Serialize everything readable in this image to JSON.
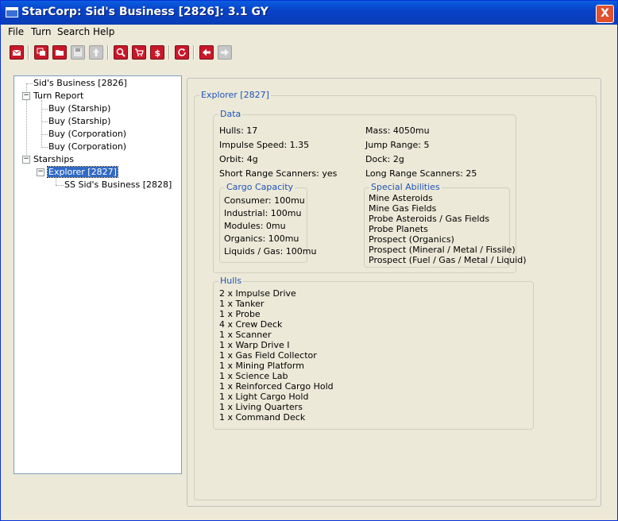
{
  "window": {
    "title": "StarCorp: Sid's Business [2826]: 3.1 GY",
    "close_label": "X"
  },
  "menu": [
    "File",
    "Turn",
    "Search",
    "Help"
  ],
  "toolbar": {
    "buttons": [
      "mail-icon",
      "copy-window-icon",
      "open-folder-icon",
      "save-icon",
      "upload-icon",
      "search-icon",
      "cart-icon",
      "dollar-icon",
      "refresh-icon",
      "back-arrow-icon",
      "forward-arrow-icon"
    ]
  },
  "tree": {
    "root": "Sid's Business [2826]",
    "turn_report": "Turn Report",
    "turn_items": [
      "Buy (Starship)",
      "Buy (Starship)",
      "Buy (Corporation)",
      "Buy (Corporation)"
    ],
    "starships": "Starships",
    "explorer": "Explorer [2827]",
    "ss": "SS Sid's Business [2828]"
  },
  "panel": {
    "title": "Explorer [2827]",
    "data_label": "Data",
    "data_left": [
      "Hulls: 17",
      "Impulse Speed: 1.35",
      "Orbit: 4g",
      "Short Range Scanners: yes"
    ],
    "data_right": [
      "Mass: 4050mu",
      "Jump Range: 5",
      "Dock: 2g",
      "Long Range Scanners: 25"
    ],
    "cargo_label": "Cargo Capacity",
    "cargo": [
      "Consumer: 100mu",
      "Industrial: 100mu",
      "Modules: 0mu",
      "Organics: 100mu",
      "Liquids / Gas: 100mu"
    ],
    "abilities_label": "Special Abilities",
    "abilities": [
      "Mine Asteroids",
      "Mine Gas Fields",
      "Probe Asteroids / Gas Fields",
      "Probe Planets",
      "Prospect (Organics)",
      "Prospect (Mineral / Metal / Fissile)",
      "Prospect (Fuel / Gas / Metal / Liquid)"
    ],
    "hulls_label": "Hulls",
    "hulls": [
      "2 x Impulse Drive",
      "1 x Tanker",
      "1 x Probe",
      "4 x Crew Deck",
      "1 x Scanner",
      "1 x Warp Drive I",
      "1 x Gas Field Collector",
      "1 x Mining Platform",
      "1 x Science Lab",
      "1 x Reinforced Cargo Hold",
      "1 x Light Cargo Hold",
      "1 x Living Quarters",
      "1 x Command Deck"
    ]
  },
  "colors": {
    "titlebar": "#0a49d0",
    "accent": "#2153b6",
    "selection": "#316ac5",
    "toolbar_red": "#c8182a"
  }
}
